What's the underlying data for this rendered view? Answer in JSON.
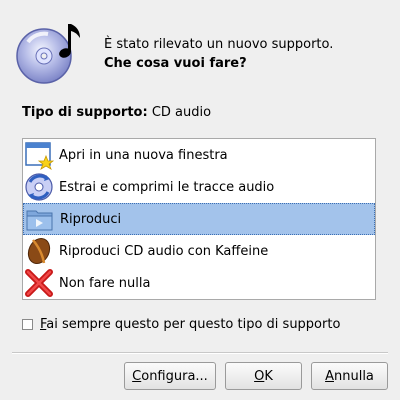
{
  "header": {
    "line1": "È stato rilevato un nuovo supporto.",
    "line2": "Che cosa vuoi fare?",
    "icon": "cd-audio-icon"
  },
  "media_type": {
    "label": "Tipo di supporto:",
    "value": "CD audio"
  },
  "actions": [
    {
      "label": "Apri in una nuova finestra",
      "icon": "new-window-icon",
      "selected": false
    },
    {
      "label": "Estrai e comprimi le tracce audio",
      "icon": "rip-audio-icon",
      "selected": false
    },
    {
      "label": "Riproduci",
      "icon": "play-folder-icon",
      "selected": true
    },
    {
      "label": "Riproduci CD audio con Kaffeine",
      "icon": "kaffeine-icon",
      "selected": false
    },
    {
      "label": "Non fare nulla",
      "icon": "red-x-icon",
      "selected": false
    }
  ],
  "always_checkbox": {
    "label_first": "F",
    "label_rest": "ai sempre questo per questo tipo di supporto",
    "checked": false
  },
  "buttons": {
    "configure_first": "C",
    "configure_rest": "onfigura...",
    "ok_first": "O",
    "ok_rest": "K",
    "cancel_first": "A",
    "cancel_rest": "nnulla"
  },
  "colors": {
    "window_bg": "#efefef",
    "selection_bg": "#a3c3eb",
    "list_bg": "#ffffff"
  }
}
